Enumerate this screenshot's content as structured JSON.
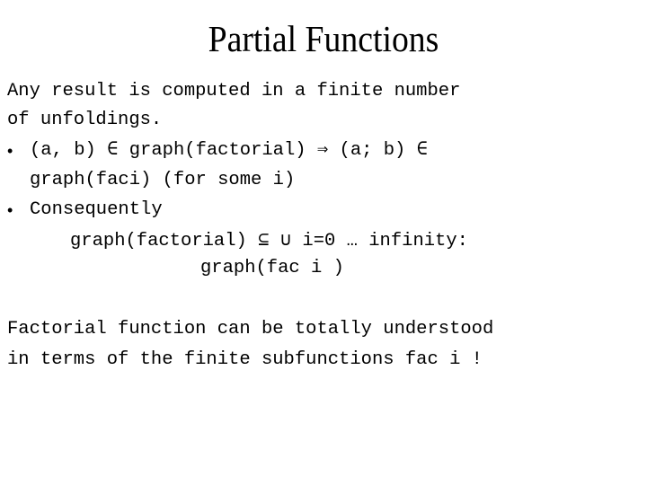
{
  "slide": {
    "title": "Partial Functions",
    "intro": {
      "line1": "Any result is computed in a finite number",
      "line2": "of unfoldings."
    },
    "bullets": [
      {
        "marker": "•",
        "line1": "(a, b) ∈ graph(factorial) ⇒ (a; b) ∈",
        "line2": "graph(faci) (for some i)"
      },
      {
        "marker": "•",
        "line1": "Consequently",
        "formula_line1": "graph(factorial) ⊆ ∪ i=0 … infinity:",
        "formula_line2": "graph(fac i )"
      }
    ],
    "conclusion": {
      "line1": "Factorial function can be totally understood",
      "line2": "in terms of the finite subfunctions fac i !"
    }
  }
}
